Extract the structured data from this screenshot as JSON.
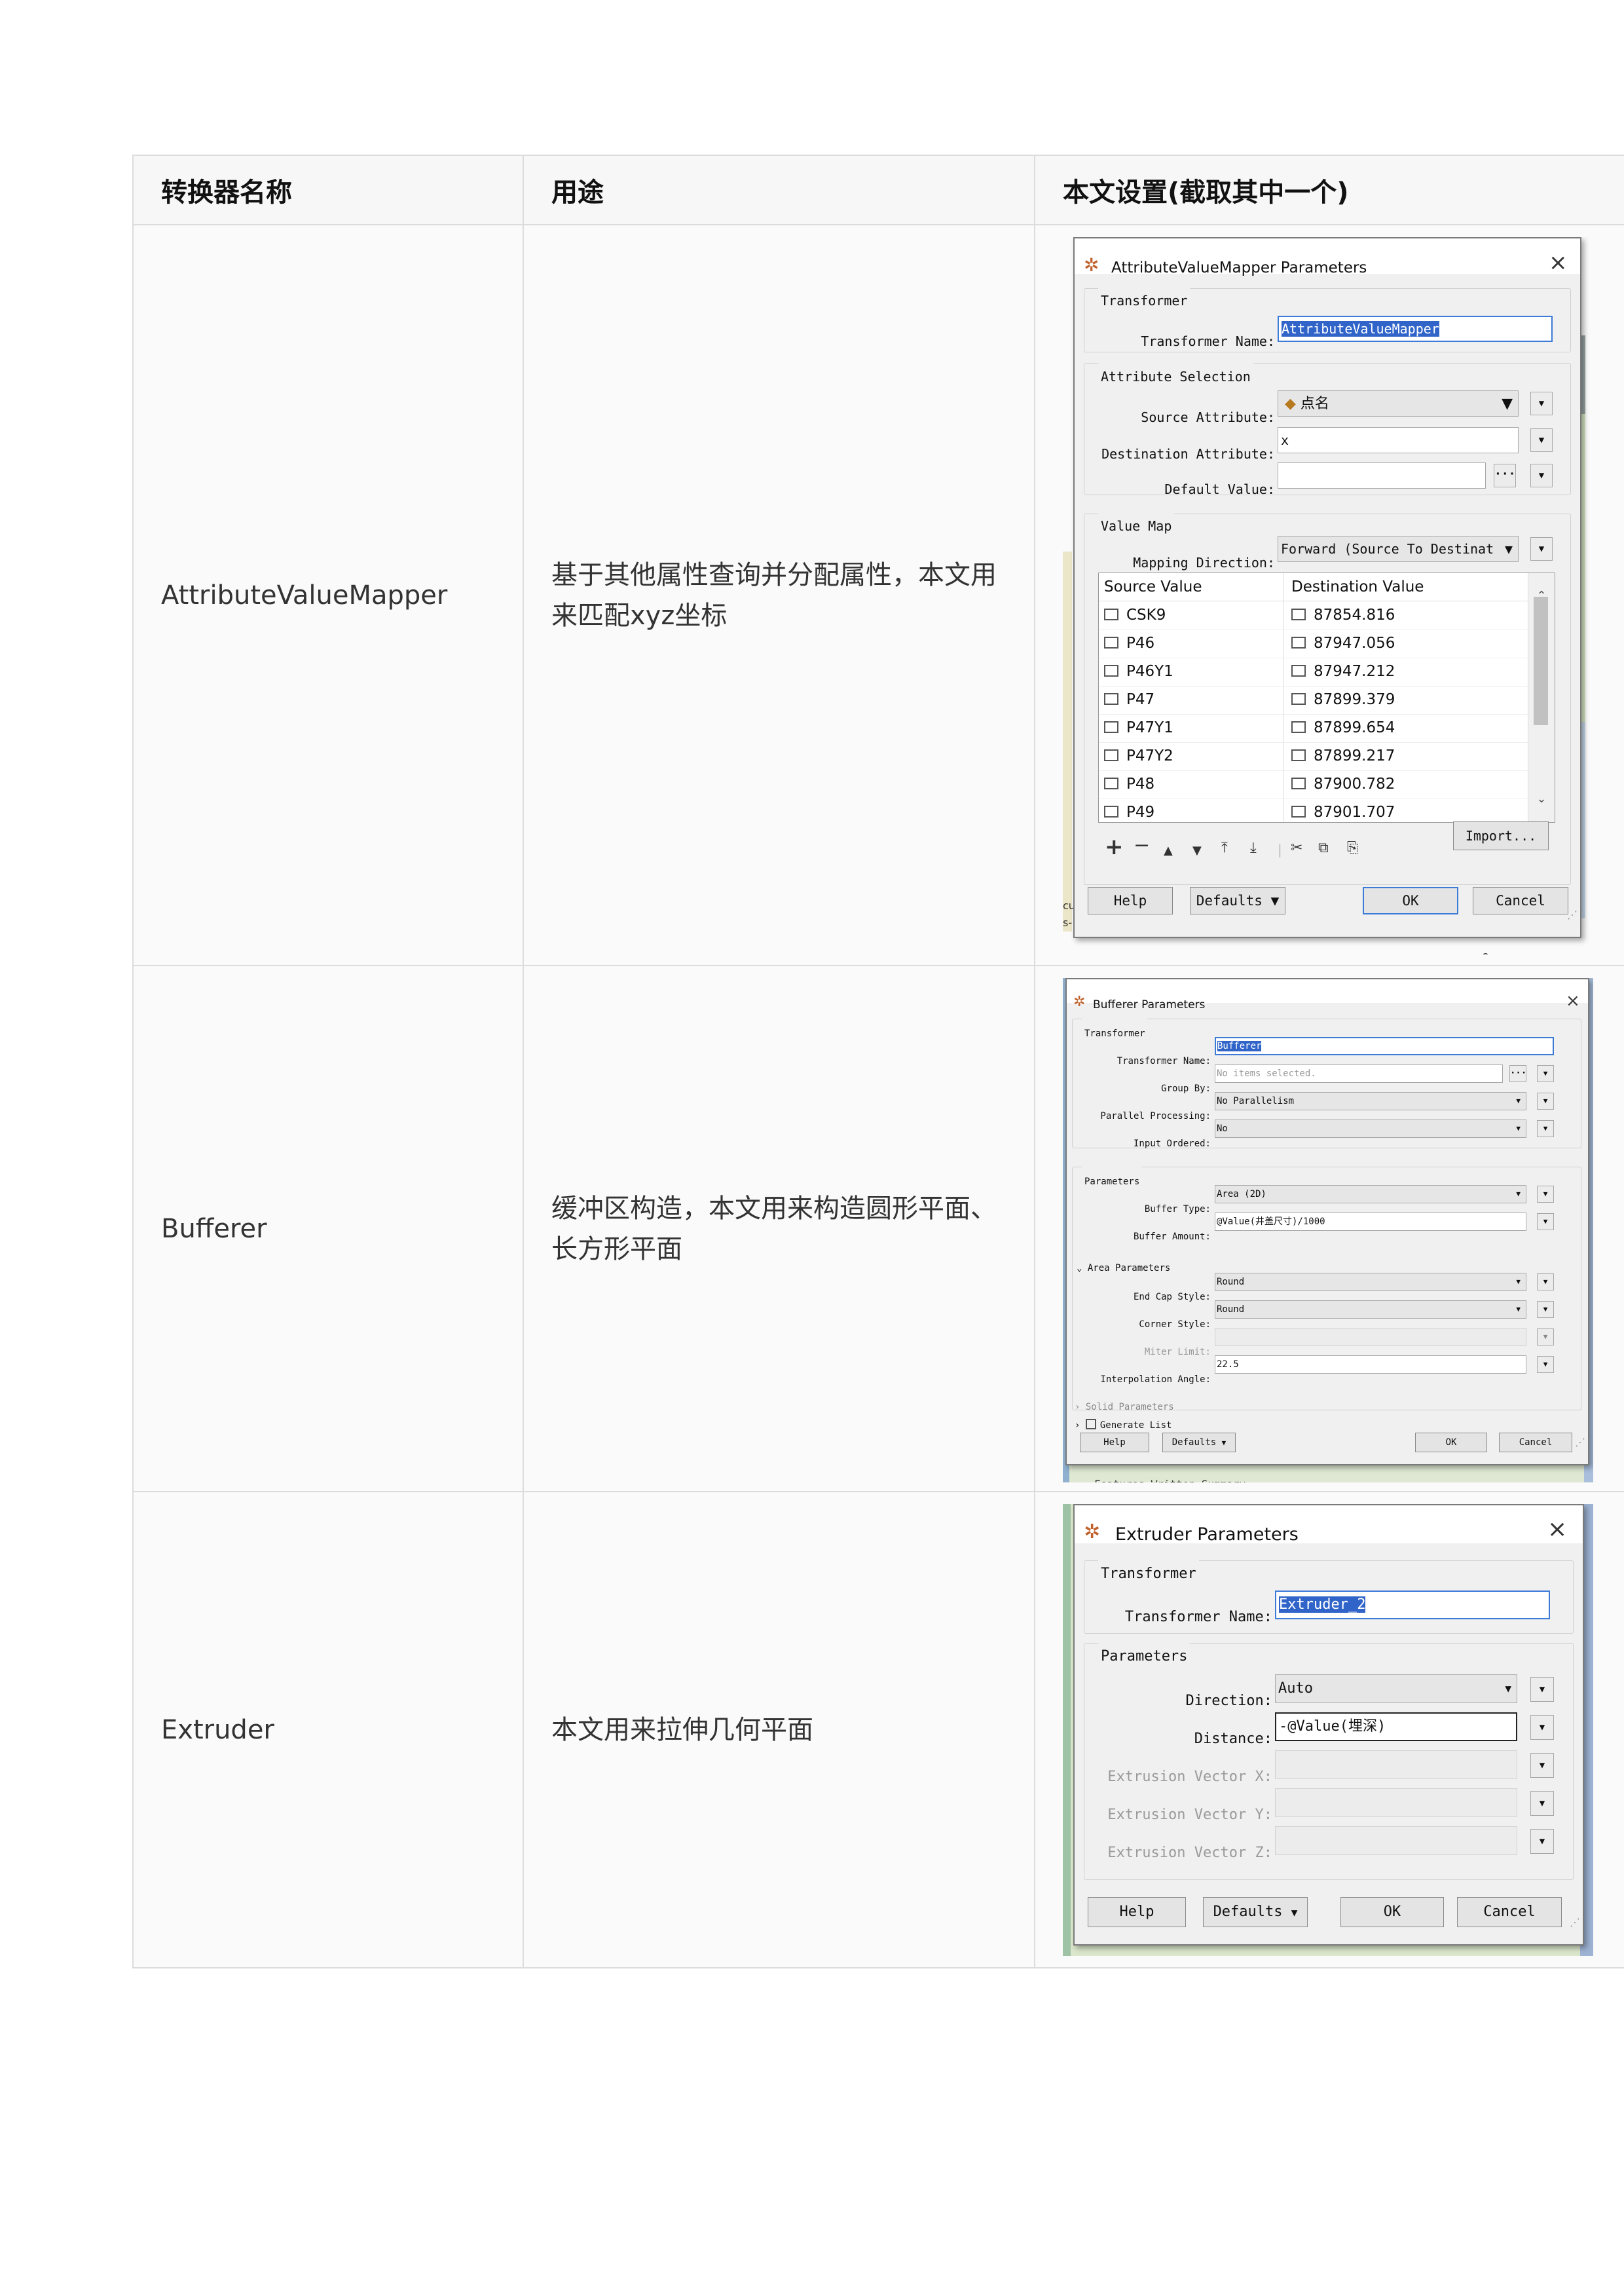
{
  "table": {
    "headers": [
      "转换器名称",
      "用途",
      "本文设置(截取其中一个)"
    ],
    "rows": [
      {
        "name": "AttributeValueMapper",
        "purpose": "基于其他属性查询并分配属性，本文用来匹配xyz坐标"
      },
      {
        "name": "Bufferer",
        "purpose": "缓冲区构造，本文用来构造圆形平面、长方形平面"
      },
      {
        "name": "Extruder",
        "purpose": "本文用来拉伸几何平面"
      }
    ]
  },
  "dialog1": {
    "title": "AttributeValueMapper Parameters",
    "group_transformer": "Transformer",
    "transformer_name_label": "Transformer Name:",
    "transformer_name": "AttributeValueMapper",
    "group_attribute": "Attribute Selection",
    "source_attribute_label": "Source Attribute:",
    "source_attribute": "点名",
    "destination_attribute_label": "Destination Attribute:",
    "destination_attribute": "x",
    "default_value_label": "Default Value:",
    "default_value": "",
    "group_valuemap": "Value Map",
    "mapping_direction_label": "Mapping Direction:",
    "mapping_direction": "Forward (Source To Destinat",
    "col_source": "Source Value",
    "col_destination": "Destination Value",
    "rows": [
      {
        "src": "CSK9",
        "dst": "87854.816"
      },
      {
        "src": "P46",
        "dst": "87947.056"
      },
      {
        "src": "P46Y1",
        "dst": "87947.212"
      },
      {
        "src": "P47",
        "dst": "87899.379"
      },
      {
        "src": "P47Y1",
        "dst": "87899.654"
      },
      {
        "src": "P47Y2",
        "dst": "87899.217"
      },
      {
        "src": "P48",
        "dst": "87900.782"
      },
      {
        "src": "P49",
        "dst": "87901.707"
      }
    ],
    "import_label": "Import...",
    "help_label": "Help",
    "defaults_label": "Defaults",
    "ok_label": "OK",
    "cancel_label": "Cancel",
    "bg_fragment_right": "r,",
    "bg_fragment_left1": "cu",
    "bg_fragment_left2": "s-",
    "bg_fragment_bottom": "9"
  },
  "dialog2": {
    "title": "Bufferer Parameters",
    "group_transformer": "Transformer",
    "transformer_name_label": "Transformer Name:",
    "transformer_name": "Bufferer",
    "group_by_label": "Group By:",
    "group_by_placeholder": "No items selected.",
    "parallel_label": "Parallel Processing:",
    "parallel_value": "No Parallelism",
    "input_ordered_label": "Input Ordered:",
    "input_ordered_value": "No",
    "group_parameters": "Parameters",
    "buffer_type_label": "Buffer Type:",
    "buffer_type_value": "Area (2D)",
    "buffer_amount_label": "Buffer Amount:",
    "buffer_amount_value": "@Value(井盖尺寸)/1000",
    "group_area": "Area Parameters",
    "end_cap_label": "End Cap Style:",
    "end_cap_value": "Round",
    "corner_label": "Corner Style:",
    "corner_value": "Round",
    "miter_label": "Miter Limit:",
    "interp_label": "Interpolation Angle:",
    "interp_value": "22.5",
    "solid_label": "Solid Parameters",
    "generate_label": "Generate List",
    "help_label": "Help",
    "defaults_label": "Defaults",
    "ok_label": "OK",
    "cancel_label": "Cancel",
    "bg_fragment_bottom": "Features Written Summary"
  },
  "dialog3": {
    "title": "Extruder Parameters",
    "group_transformer": "Transformer",
    "transformer_name_label": "Transformer Name:",
    "transformer_name": "Extruder_2",
    "group_parameters": "Parameters",
    "direction_label": "Direction:",
    "direction_value": "Auto",
    "distance_label": "Distance:",
    "distance_value": "-@Value(埋深)",
    "vx_label": "Extrusion Vector X:",
    "vy_label": "Extrusion Vector Y:",
    "vz_label": "Extrusion Vector Z:",
    "help_label": "Help",
    "defaults_label": "Defaults",
    "ok_label": "OK",
    "cancel_label": "Cancel"
  },
  "icons": [
    "transformer-icon",
    "close-icon",
    "dropdown-arrow-icon",
    "attribute-icon",
    "ellipsis-icon",
    "add-icon",
    "remove-icon",
    "move-up-icon",
    "move-down-icon",
    "move-top-icon",
    "move-bottom-icon",
    "cut-icon",
    "copy-icon",
    "paste-icon"
  ]
}
